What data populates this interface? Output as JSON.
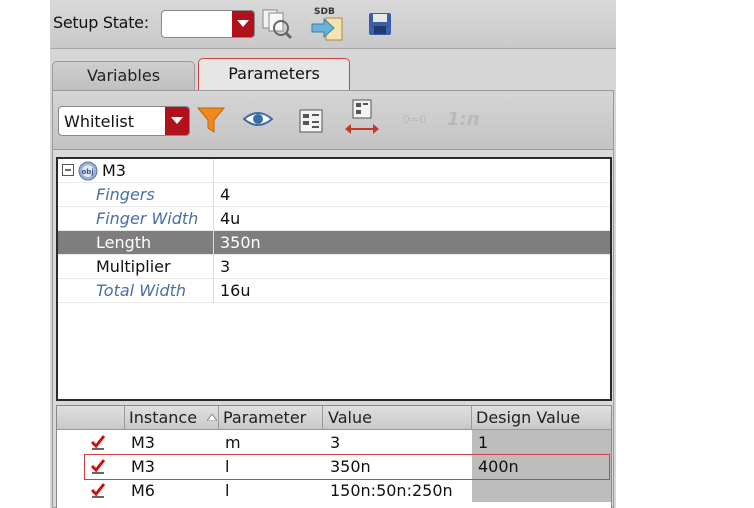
{
  "toolbar": {
    "setup_state_label": "Setup State:",
    "setup_state_value": "",
    "sdb_icon_text": "SDB"
  },
  "tabs": [
    {
      "label": "Variables",
      "active": false
    },
    {
      "label": "Parameters",
      "active": true
    }
  ],
  "filter": {
    "mode": "Whitelist",
    "ratio_label": "1:n",
    "equal_label": "0=0"
  },
  "tree": {
    "root": "M3",
    "root_icon_text": "obj",
    "rows": [
      {
        "name": "Fingers",
        "value": "4",
        "italic": true,
        "selected": false
      },
      {
        "name": "Finger Width",
        "value": "4u",
        "italic": true,
        "selected": false
      },
      {
        "name": "Length",
        "value": "350n",
        "italic": false,
        "selected": true
      },
      {
        "name": "Multiplier",
        "value": "3",
        "italic": false,
        "selected": false
      },
      {
        "name": "Total Width",
        "value": "16u",
        "italic": true,
        "selected": false
      }
    ]
  },
  "table": {
    "columns": [
      "Instance",
      "Parameter",
      "Value",
      "Design Value"
    ],
    "rows": [
      {
        "checked": true,
        "instance": "M3",
        "parameter": "m",
        "value": "3",
        "design_value": "1"
      },
      {
        "checked": true,
        "instance": "M3",
        "parameter": "l",
        "value": "350n",
        "design_value": "400n"
      },
      {
        "checked": true,
        "instance": "M6",
        "parameter": "l",
        "value": "150n:50n:250n",
        "design_value": ""
      }
    ]
  },
  "colors": {
    "accent_red": "#b0111a",
    "selection_gray": "#7e7e7e",
    "highlight_border": "#d64040",
    "check_red": "#cc1111"
  }
}
